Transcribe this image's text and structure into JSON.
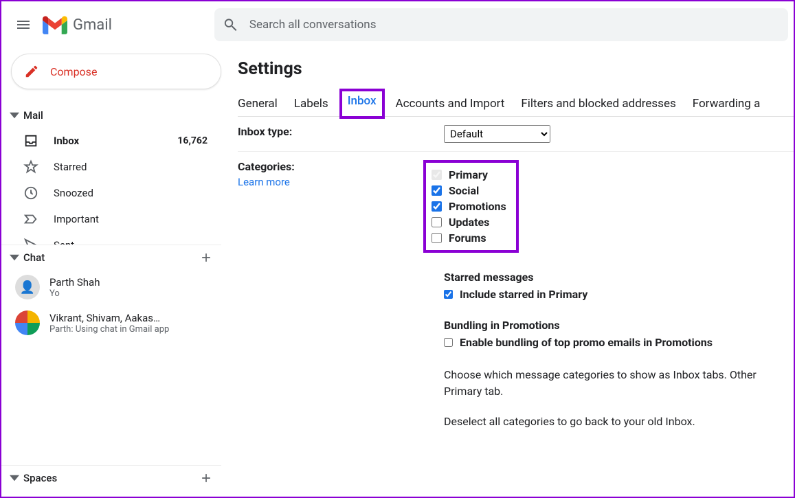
{
  "header": {
    "logo_text": "Gmail",
    "search_placeholder": "Search all conversations"
  },
  "compose": {
    "label": "Compose"
  },
  "sidebar": {
    "mail_label": "Mail",
    "chat_label": "Chat",
    "spaces_label": "Spaces",
    "items": [
      {
        "label": "Inbox",
        "count": "16,762",
        "active": true
      },
      {
        "label": "Starred"
      },
      {
        "label": "Snoozed"
      },
      {
        "label": "Important"
      },
      {
        "label": "Sent"
      }
    ],
    "chats": [
      {
        "name": "Parth Shah",
        "snippet": "Yo"
      },
      {
        "name": "Vikrant, Shivam, Aakas…",
        "snippet": "Parth: Using chat in Gmail app"
      }
    ]
  },
  "settings": {
    "title": "Settings",
    "tabs": [
      "General",
      "Labels",
      "Inbox",
      "Accounts and Import",
      "Filters and blocked addresses",
      "Forwarding a"
    ],
    "active_tab_index": 2,
    "inbox_type": {
      "label": "Inbox type:",
      "value": "Default"
    },
    "categories": {
      "label": "Categories:",
      "learn_more": "Learn more",
      "items": [
        {
          "label": "Primary",
          "checked": true,
          "disabled": true
        },
        {
          "label": "Social",
          "checked": true,
          "disabled": false
        },
        {
          "label": "Promotions",
          "checked": true,
          "disabled": false
        },
        {
          "label": "Updates",
          "checked": false,
          "disabled": false
        },
        {
          "label": "Forums",
          "checked": false,
          "disabled": false
        }
      ],
      "starred_title": "Starred messages",
      "starred_check_label": "Include starred in Primary",
      "starred_checked": true,
      "bundling_title": "Bundling in Promotions",
      "bundling_check_label": "Enable bundling of top promo emails in Promotions",
      "bundling_checked": false,
      "desc1": "Choose which message categories to show as Inbox tabs. Other Primary tab.",
      "desc2": "Deselect all categories to go back to your old Inbox."
    }
  }
}
